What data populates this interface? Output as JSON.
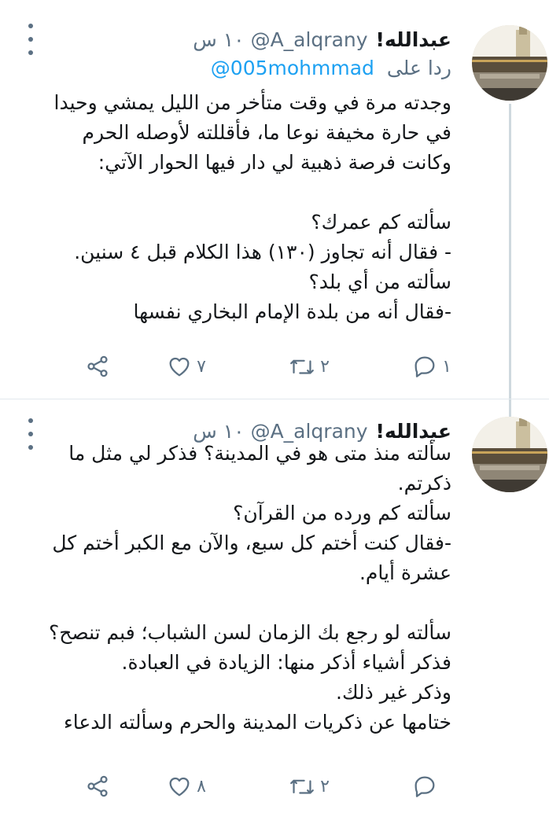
{
  "tweets": [
    {
      "author_name": "عبدالله!",
      "handle": "@A_alqrany",
      "time": "١٠ س",
      "reply_label": "ردا على",
      "reply_handle": "@005mohmmad",
      "lines": [
        "وجدته مرة في وقت متأخر من الليل يمشي وحيدا",
        "في حارة مخيفة نوعا ما، فأقللته لأوصله الحرم",
        "وكانت فرصة ذهبية  لي دار فيها الحوار الآتي:",
        "",
        "سألته كم عمرك؟",
        "- فقال أنه تجاوز (١٣٠) هذا الكلام قبل ٤ سنين.",
        "سألته من أي بلد؟",
        "-فقال أنه من بلدة الإمام البخاري نفسها"
      ],
      "reply_count": "١",
      "retweet_count": "٢",
      "like_count": "٧"
    },
    {
      "author_name": "عبدالله!",
      "handle": "@A_alqrany",
      "time": "١٠ س",
      "lines": [
        "سألته منذ متى هو في المدينة؟ فذكر لي مثل ما",
        "ذكرتم.",
        "سألته كم ورده من القرآن؟",
        "-فقال كنت أختم كل سبع، والآن مع الكبر أختم كل",
        "عشرة أيام.",
        "",
        "سألته لو رجع بك الزمان لسن الشباب؛ فبم تنصح؟",
        "فذكر أشياء أذكر منها: الزيادة في العبادة.",
        "وذكر غير ذلك.",
        "ختامها عن ذكريات المدينة والحرم وسألته الدعاء"
      ],
      "reply_count": "",
      "retweet_count": "٢",
      "like_count": "٨"
    }
  ],
  "icons": {
    "reply": "reply-icon",
    "retweet": "retweet-icon",
    "like": "heart-icon",
    "share": "share-icon",
    "more": "more-vertical-icon"
  },
  "colors": {
    "text": "#14171a",
    "secondary": "#5b7083",
    "link": "#1da1f2",
    "divider": "#e1e8ed",
    "thread_line": "#cfd9de"
  }
}
